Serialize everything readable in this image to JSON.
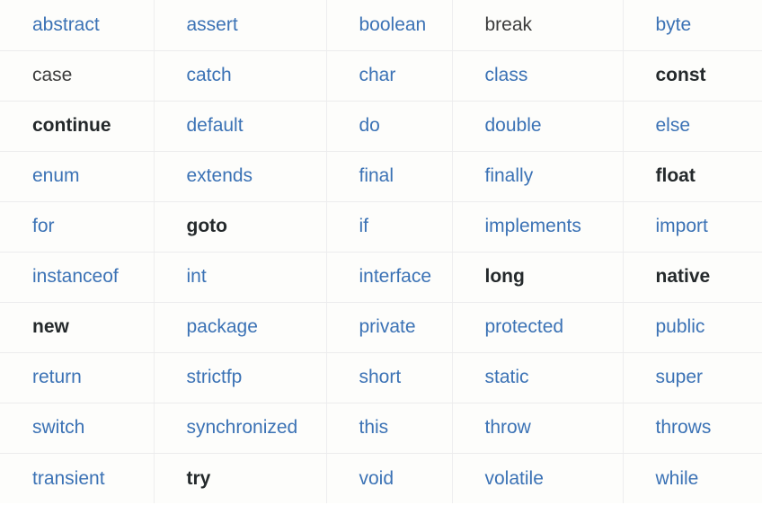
{
  "table": {
    "kind": "java-keyword-reference-table",
    "row_count": 10,
    "column_count": 5,
    "colors": {
      "link": "#3b72b5",
      "plain_text": "#3c3c3c",
      "strong_text": "#24292b",
      "row_separator": "#ececed",
      "column_separator": "#eeeeef",
      "cell_background": "#fdfdfb",
      "page_background": "#ffffff"
    },
    "rows": [
      [
        {
          "label": "abstract",
          "style": "link"
        },
        {
          "label": "assert",
          "style": "link"
        },
        {
          "label": "boolean",
          "style": "link"
        },
        {
          "label": "break",
          "style": "plain"
        },
        {
          "label": "byte",
          "style": "link"
        }
      ],
      [
        {
          "label": "case",
          "style": "plain"
        },
        {
          "label": "catch",
          "style": "link"
        },
        {
          "label": "char",
          "style": "link"
        },
        {
          "label": "class",
          "style": "link"
        },
        {
          "label": "const",
          "style": "strong"
        }
      ],
      [
        {
          "label": "continue",
          "style": "strong"
        },
        {
          "label": "default",
          "style": "link"
        },
        {
          "label": "do",
          "style": "link"
        },
        {
          "label": "double",
          "style": "link"
        },
        {
          "label": "else",
          "style": "link"
        }
      ],
      [
        {
          "label": "enum",
          "style": "link"
        },
        {
          "label": "extends",
          "style": "link"
        },
        {
          "label": "final",
          "style": "link"
        },
        {
          "label": "finally",
          "style": "link"
        },
        {
          "label": "float",
          "style": "strong"
        }
      ],
      [
        {
          "label": "for",
          "style": "link"
        },
        {
          "label": "goto",
          "style": "strong"
        },
        {
          "label": "if",
          "style": "link"
        },
        {
          "label": "implements",
          "style": "link"
        },
        {
          "label": "import",
          "style": "link"
        }
      ],
      [
        {
          "label": "instanceof",
          "style": "link"
        },
        {
          "label": "int",
          "style": "link"
        },
        {
          "label": "interface",
          "style": "link"
        },
        {
          "label": "long",
          "style": "strong"
        },
        {
          "label": "native",
          "style": "strong"
        }
      ],
      [
        {
          "label": "new",
          "style": "strong"
        },
        {
          "label": "package",
          "style": "link"
        },
        {
          "label": "private",
          "style": "link"
        },
        {
          "label": "protected",
          "style": "link"
        },
        {
          "label": "public",
          "style": "link"
        }
      ],
      [
        {
          "label": "return",
          "style": "link"
        },
        {
          "label": "strictfp",
          "style": "link"
        },
        {
          "label": "short",
          "style": "link"
        },
        {
          "label": "static",
          "style": "link"
        },
        {
          "label": "super",
          "style": "link"
        }
      ],
      [
        {
          "label": "switch",
          "style": "link"
        },
        {
          "label": "synchronized",
          "style": "link"
        },
        {
          "label": "this",
          "style": "link"
        },
        {
          "label": "throw",
          "style": "link"
        },
        {
          "label": "throws",
          "style": "link"
        }
      ],
      [
        {
          "label": "transient",
          "style": "link"
        },
        {
          "label": "try",
          "style": "strong"
        },
        {
          "label": "void",
          "style": "link"
        },
        {
          "label": "volatile",
          "style": "link"
        },
        {
          "label": "while",
          "style": "link"
        }
      ]
    ]
  }
}
